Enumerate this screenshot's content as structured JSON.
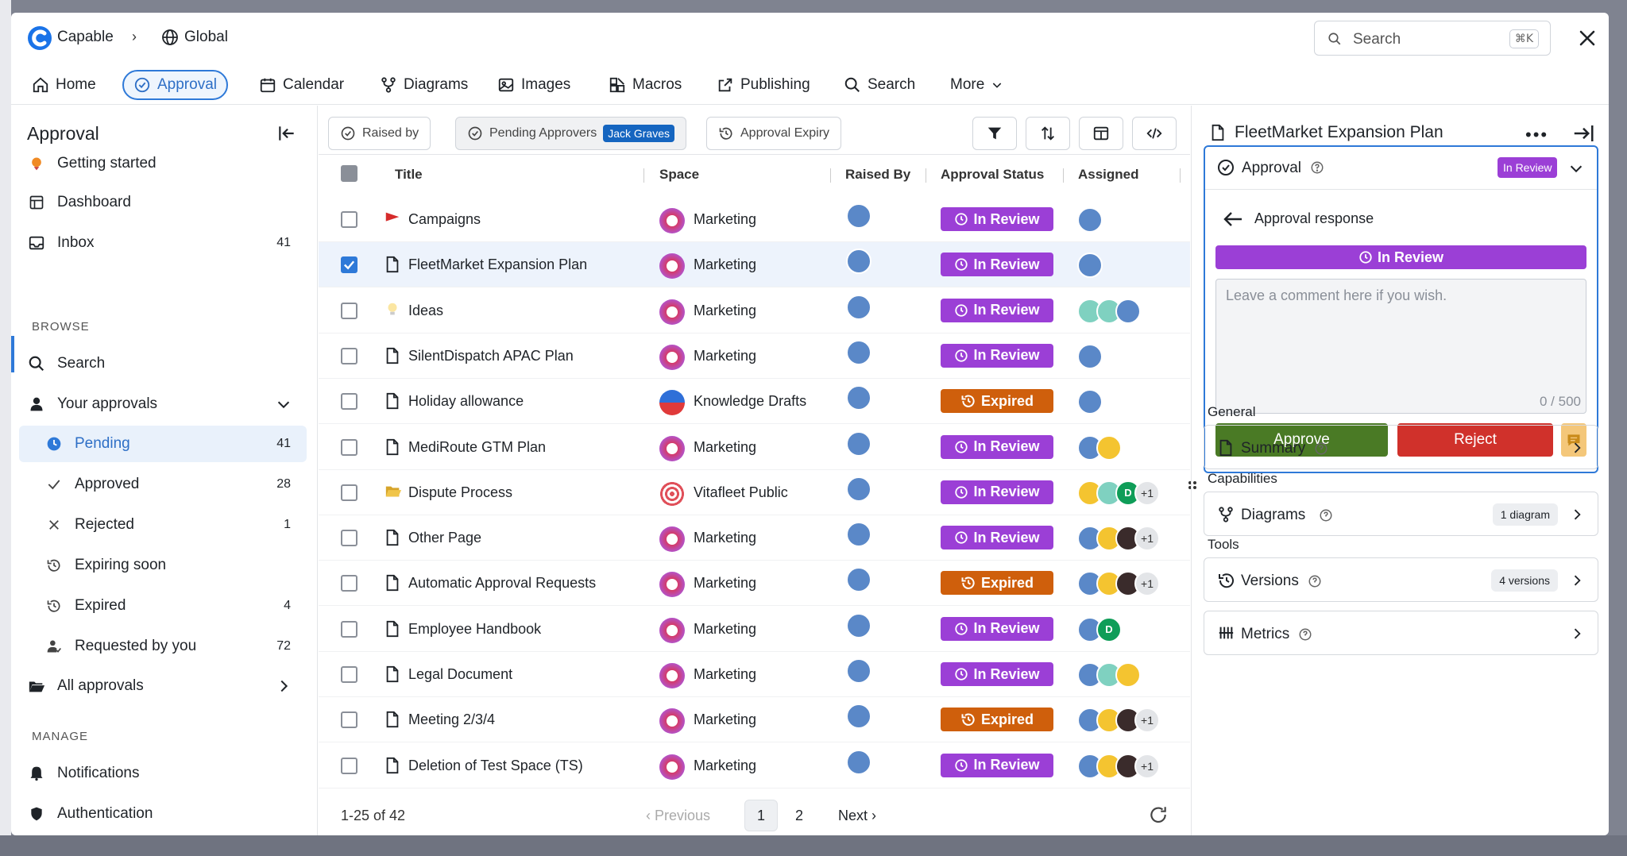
{
  "app": {
    "brand": "Capable",
    "breadcrumb_global": "Global",
    "search_placeholder": "Search",
    "search_shortcut": "⌘K"
  },
  "nav": {
    "home": "Home",
    "approval": "Approval",
    "calendar": "Calendar",
    "diagrams": "Diagrams",
    "images": "Images",
    "macros": "Macros",
    "publishing": "Publishing",
    "search": "Search",
    "more": "More"
  },
  "sidebar": {
    "title": "Approval",
    "getting_started": "Getting started",
    "dashboard": "Dashboard",
    "inbox": "Inbox",
    "inbox_count": "41",
    "browse": "BROWSE",
    "search": "Search",
    "your_approvals": "Your approvals",
    "pending": "Pending",
    "pending_count": "41",
    "approved": "Approved",
    "approved_count": "28",
    "rejected": "Rejected",
    "rejected_count": "1",
    "expiring_soon": "Expiring soon",
    "expired": "Expired",
    "expired_count": "4",
    "requested_by_you": "Requested by you",
    "requested_count": "72",
    "all_approvals": "All approvals",
    "manage": "MANAGE",
    "notifications": "Notifications",
    "authentication": "Authentication"
  },
  "filters": {
    "raised_by": "Raised by",
    "pending_approvers": "Pending Approvers",
    "pending_approvers_value": "Jack Graves",
    "approval_expiry": "Approval Expiry"
  },
  "table": {
    "headers": {
      "title": "Title",
      "space": "Space",
      "raised_by": "Raised By",
      "status": "Approval Status",
      "assigned": "Assigned"
    },
    "rows": [
      {
        "title": "Campaigns",
        "space": "Marketing",
        "status": "In Review"
      },
      {
        "title": "FleetMarket Expansion Plan",
        "space": "Marketing",
        "status": "In Review"
      },
      {
        "title": "Ideas",
        "space": "Marketing",
        "status": "In Review"
      },
      {
        "title": "SilentDispatch APAC Plan",
        "space": "Marketing",
        "status": "In Review"
      },
      {
        "title": "Holiday allowance",
        "space": "Knowledge Drafts",
        "status": "Expired"
      },
      {
        "title": "MediRoute GTM Plan",
        "space": "Marketing",
        "status": "In Review"
      },
      {
        "title": "Dispute Process",
        "space": "Vitafleet Public",
        "status": "In Review"
      },
      {
        "title": "Other Page",
        "space": "Marketing",
        "status": "In Review"
      },
      {
        "title": "Automatic Approval Requests",
        "space": "Marketing",
        "status": "Expired"
      },
      {
        "title": "Employee Handbook",
        "space": "Marketing",
        "status": "In Review"
      },
      {
        "title": "Legal Document",
        "space": "Marketing",
        "status": "In Review"
      },
      {
        "title": "Meeting 2/3/4",
        "space": "Marketing",
        "status": "Expired"
      },
      {
        "title": "Deletion of Test Space (TS)",
        "space": "Marketing",
        "status": "In Review"
      }
    ],
    "more_label": "+1",
    "avatar_letter": "D"
  },
  "pagination": {
    "range": "1-25 of 42",
    "previous": "Previous",
    "page1": "1",
    "page2": "2",
    "next": "Next"
  },
  "panel": {
    "title": "FleetMarket Expansion Plan",
    "approval": "Approval",
    "approval_badge": "In Review",
    "response_title": "Approval response",
    "status_bar": "In Review",
    "comment_placeholder": "Leave a comment here if you wish.",
    "comment_count": "0 / 500",
    "approve": "Approve",
    "reject": "Reject",
    "general": "General",
    "summary": "Summary",
    "capabilities": "Capabilities",
    "diagrams": "Diagrams",
    "diagrams_tag": "1 diagram",
    "tools": "Tools",
    "versions": "Versions",
    "versions_tag": "4 versions",
    "metrics": "Metrics"
  },
  "colors": {
    "accent": "#2e79d8",
    "in_review": "#9b3fd6",
    "expired": "#cf5f0c",
    "approve": "#4a7a25",
    "reject": "#d0312b"
  }
}
